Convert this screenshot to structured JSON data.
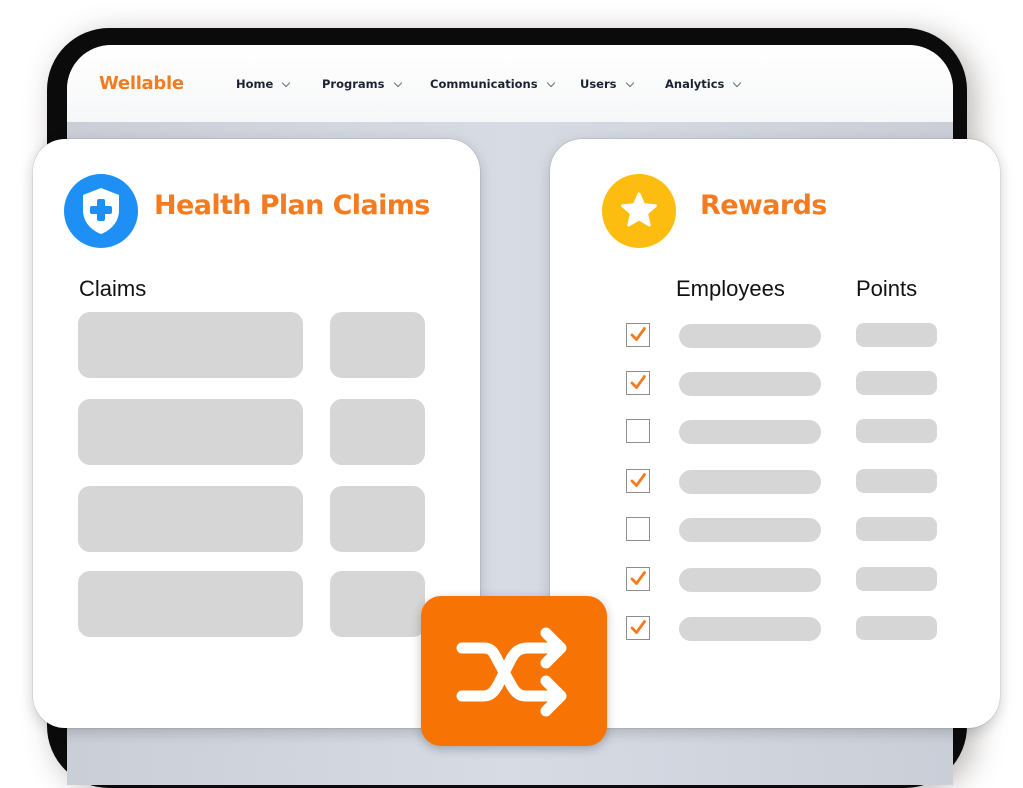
{
  "app": {
    "brand": "Wellable",
    "brand_color": "#f07d22",
    "nav": [
      {
        "label": "Home",
        "icon": "chevron-down-icon"
      },
      {
        "label": "Programs",
        "icon": "chevron-down-icon"
      },
      {
        "label": "Communications",
        "icon": "chevron-down-icon"
      },
      {
        "label": "Users",
        "icon": "chevron-down-icon"
      },
      {
        "label": "Analytics",
        "icon": "chevron-down-icon"
      }
    ]
  },
  "health_plan_card": {
    "title": "Health Plan Claims",
    "icon": "shield-plus-icon",
    "icon_color": "#1e90f5",
    "column_label": "Claims",
    "row_count": 4
  },
  "rewards_card": {
    "title": "Rewards",
    "icon": "star-icon",
    "icon_color": "#fdbd10",
    "columns": [
      "Employees",
      "Points"
    ],
    "rows": [
      {
        "checked": true
      },
      {
        "checked": true
      },
      {
        "checked": false
      },
      {
        "checked": true
      },
      {
        "checked": false
      },
      {
        "checked": true
      },
      {
        "checked": true
      }
    ]
  },
  "sync_button": {
    "icon": "shuffle-icon",
    "color": "#f77304"
  },
  "accent_color": "#f47b20"
}
